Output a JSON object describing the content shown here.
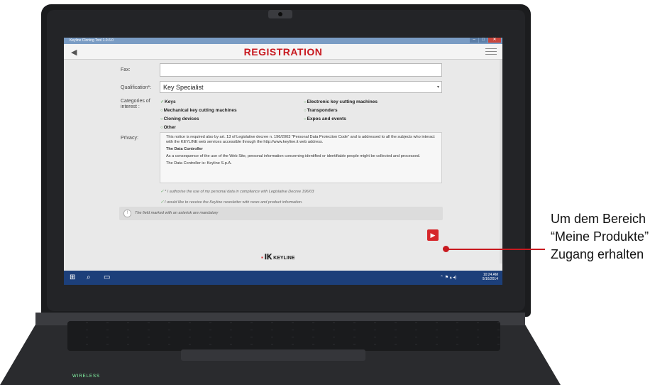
{
  "window": {
    "title": "Keyline Cloning Tool 1.0.6.0"
  },
  "app": {
    "title": "REGISTRATION",
    "back_icon": "◀",
    "menu_icon": "hamburger-icon"
  },
  "form": {
    "fax_label": "Fax:",
    "fax_value": "",
    "qualification_label": "Qualification*:",
    "qualification_value": "Key Specialist",
    "categories_label": "Categories of interest :",
    "categories": [
      {
        "label": "Keys",
        "checked": true
      },
      {
        "label": "Electronic key cutting machines",
        "checked": false
      },
      {
        "label": "Mechanical key cutting machines",
        "checked": false
      },
      {
        "label": "Transponders",
        "checked": false
      },
      {
        "label": "Cloning devices",
        "checked": false
      },
      {
        "label": "Expos and events",
        "checked": false
      },
      {
        "label": "Other",
        "checked": false
      }
    ],
    "privacy_label": "Privacy:",
    "privacy": {
      "intro": "This notice is required also by art. 13 of Legislative decree n. 196/2003 \"Personal Data Protection Code\" and is addressed to all the subjects who interact with the KEYLINE web services accessible through the http://www.keyline.it web address.",
      "heading": "The Data Controller",
      "body": "As a consequence of the use of the Web Site, personal information concerning identified or identifiable people might be collected and processed.",
      "controller": "The Data Controller is: Keyline S.p.A."
    },
    "consent_privacy": "* I authorise the use of my personal data in compliance with Legislative Decree 196/03",
    "consent_newsletter": "I would like to receive the Keyline newsletter with news and product information.",
    "mandatory_notice": "The field marked with an asterisk are mandatory"
  },
  "footer": {
    "logo_text": "KEYLINE"
  },
  "taskbar": {
    "time": "10:24 AM",
    "date": "9/16/2014"
  },
  "device": {
    "label": "WIRELESS"
  },
  "callout": {
    "line1": "Um dem Bereich",
    "line2": "“Meine Produkte”",
    "line3": "Zugang erhalten"
  },
  "colors": {
    "brand_red": "#c8191f",
    "taskbar_blue": "#1c3f7a"
  }
}
